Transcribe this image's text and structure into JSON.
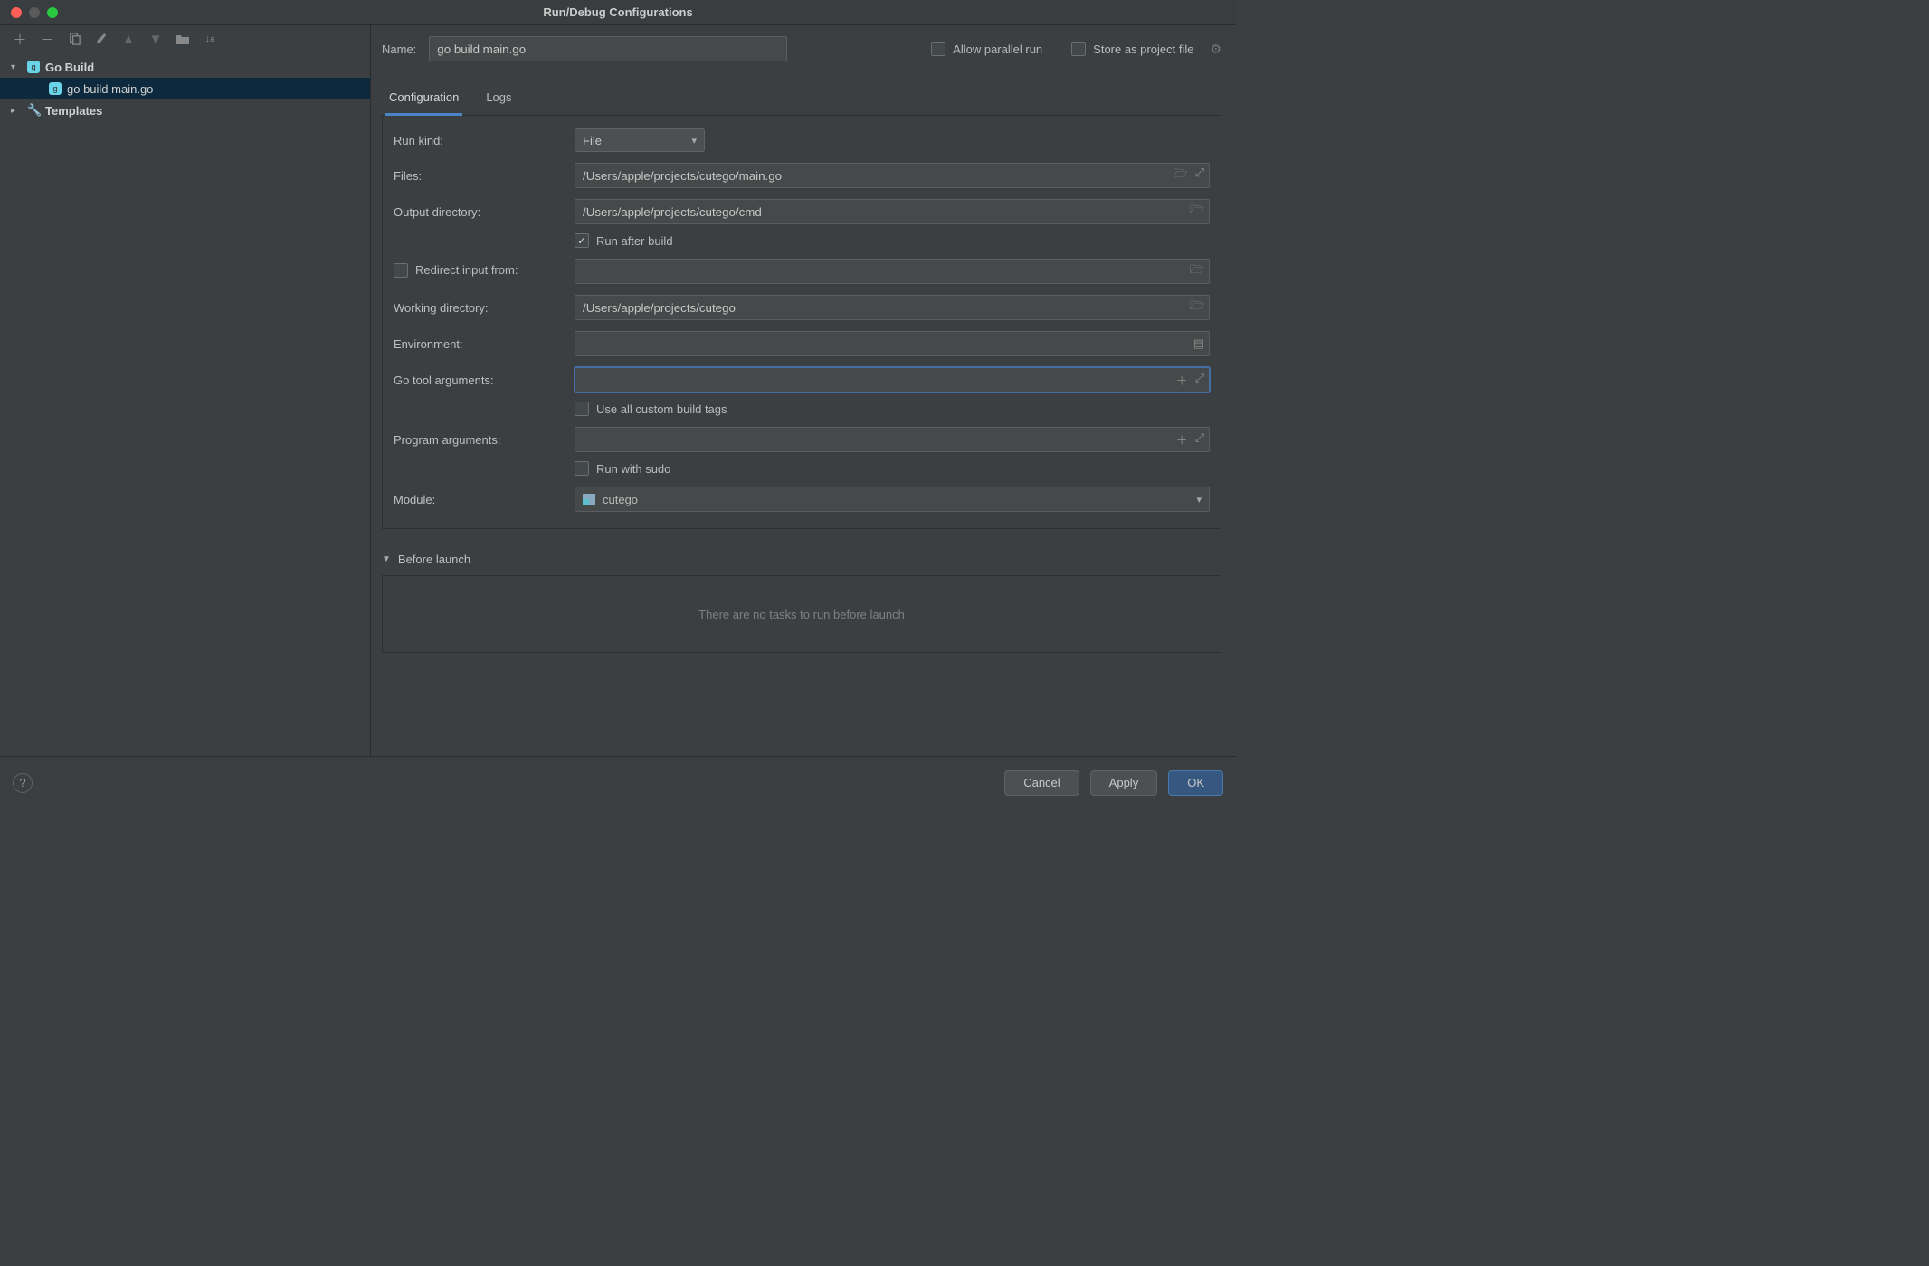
{
  "title": "Run/Debug Configurations",
  "sidebar": {
    "items": [
      {
        "label": "Go Build",
        "icon": "go-icon",
        "expanded": true,
        "bold": true,
        "children": [
          {
            "label": "go build main.go",
            "icon": "go-icon",
            "selected": true
          }
        ]
      },
      {
        "label": "Templates",
        "icon": "wrench-icon",
        "expanded": false,
        "bold": true
      }
    ]
  },
  "form": {
    "name_label": "Name:",
    "name_value": "go build main.go",
    "allow_parallel_label": "Allow parallel run",
    "store_project_label": "Store as project file",
    "tabs": {
      "config": "Configuration",
      "logs": "Logs",
      "active": "config"
    },
    "rows": {
      "run_kind": {
        "label": "Run kind:",
        "value": "File"
      },
      "files": {
        "label": "Files:",
        "value": "/Users/apple/projects/cutego/main.go"
      },
      "output_dir": {
        "label": "Output directory:",
        "value": "/Users/apple/projects/cutego/cmd"
      },
      "run_after_build": {
        "label": "Run after build",
        "checked": true
      },
      "redirect_input": {
        "label": "Redirect input from:",
        "checked": false,
        "value": ""
      },
      "working_dir": {
        "label": "Working directory:",
        "value": "/Users/apple/projects/cutego"
      },
      "environment": {
        "label": "Environment:",
        "value": ""
      },
      "go_tool_args": {
        "label": "Go tool arguments:",
        "value": ""
      },
      "use_custom_tags": {
        "label": "Use all custom build tags",
        "checked": false
      },
      "program_args": {
        "label": "Program arguments:",
        "value": ""
      },
      "run_sudo": {
        "label": "Run with sudo",
        "checked": false
      },
      "module": {
        "label": "Module:",
        "value": "cutego"
      }
    }
  },
  "before_launch": {
    "header": "Before launch",
    "empty_text": "There are no tasks to run before launch"
  },
  "footer": {
    "cancel": "Cancel",
    "apply": "Apply",
    "ok": "OK"
  }
}
